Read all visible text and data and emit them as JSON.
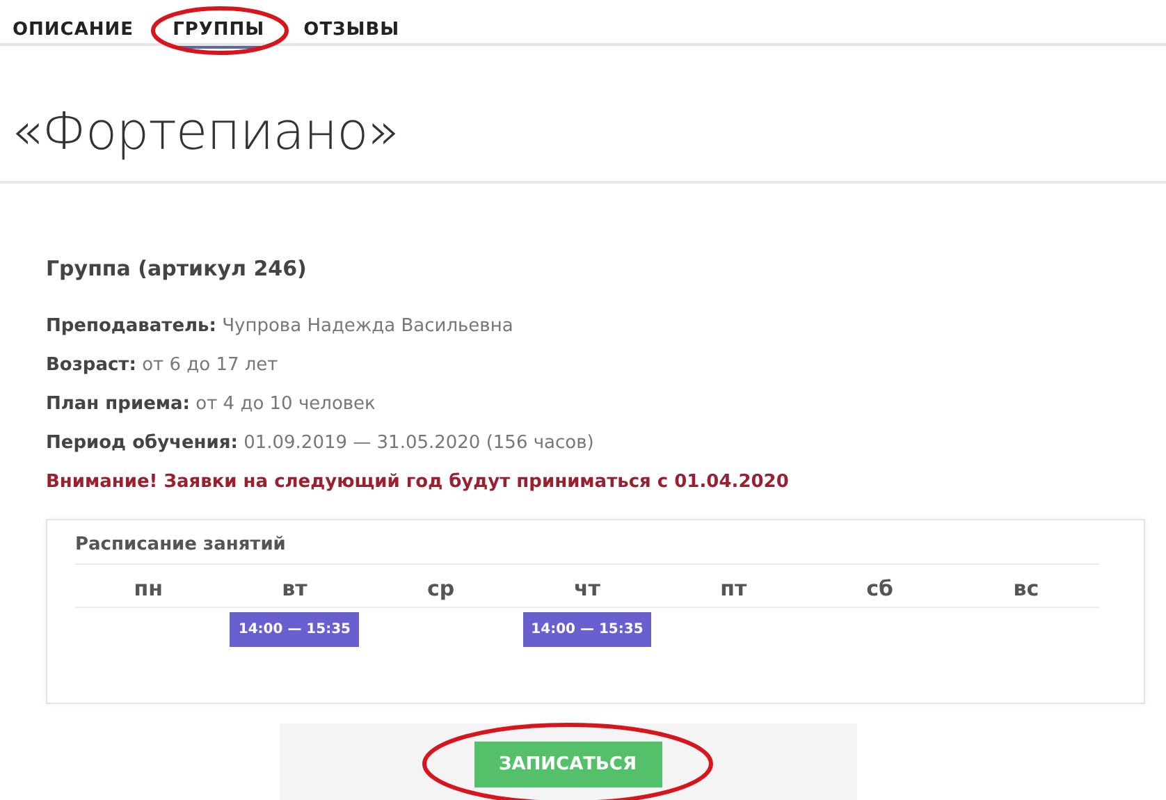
{
  "tabs": [
    {
      "label": "ОПИСАНИЕ",
      "selected": false,
      "circled": false
    },
    {
      "label": "ГРУППЫ",
      "selected": true,
      "circled": true
    },
    {
      "label": "ОТЗЫВЫ",
      "selected": false,
      "circled": false
    }
  ],
  "title": "«Фортепиано»",
  "group": {
    "title": "Группа (артикул 246)",
    "details": [
      {
        "label": "Преподаватель:",
        "value": "Чупрова Надежда Васильевна"
      },
      {
        "label": "Возраст:",
        "value": "от 6 до 17 лет"
      },
      {
        "label": "План приема:",
        "value": "от 4 до 10 человек"
      },
      {
        "label": "Период обучения:",
        "value": "01.09.2019 — 31.05.2020 (156 часов)"
      }
    ],
    "notice": "Внимание! Заявки на следующий год будут приниматься с 01.04.2020"
  },
  "schedule": {
    "title": "Расписание занятий",
    "days": [
      {
        "day": "пн"
      },
      {
        "day": "вт",
        "slot": "14:00 — 15:35"
      },
      {
        "day": "ср"
      },
      {
        "day": "чт",
        "slot": "14:00 — 15:35"
      },
      {
        "day": "пт"
      },
      {
        "day": "сб"
      },
      {
        "day": "вс"
      }
    ]
  },
  "enroll_button": {
    "label": "ЗАПИСАТЬСЯ",
    "circled": true
  }
}
